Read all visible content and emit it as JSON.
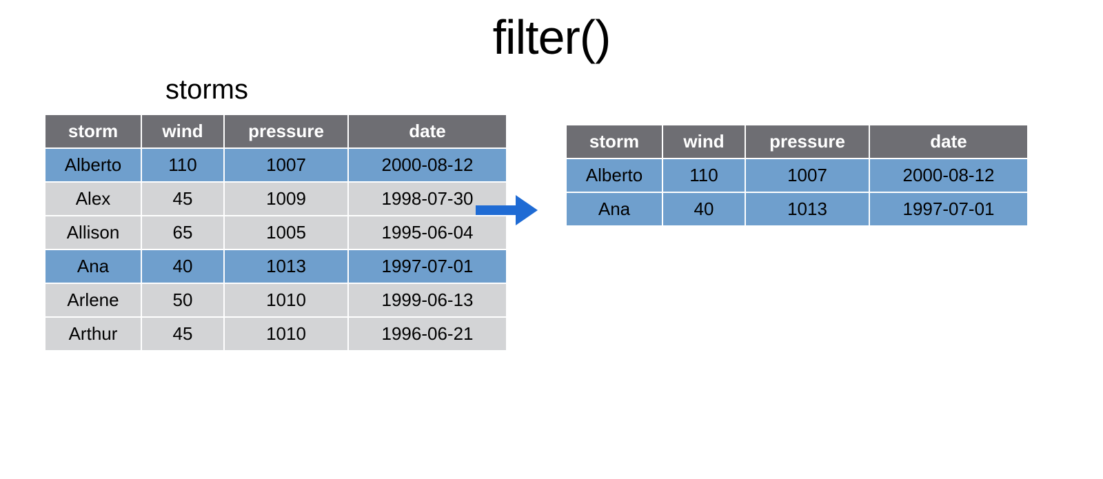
{
  "title": "filter()",
  "left_label": "storms",
  "columns": [
    "storm",
    "wind",
    "pressure",
    "date"
  ],
  "left_rows": [
    {
      "hl": true,
      "cells": [
        "Alberto",
        "110",
        "1007",
        "2000-08-12"
      ]
    },
    {
      "hl": false,
      "cells": [
        "Alex",
        "45",
        "1009",
        "1998-07-30"
      ]
    },
    {
      "hl": false,
      "cells": [
        "Allison",
        "65",
        "1005",
        "1995-06-04"
      ]
    },
    {
      "hl": true,
      "cells": [
        "Ana",
        "40",
        "1013",
        "1997-07-01"
      ]
    },
    {
      "hl": false,
      "cells": [
        "Arlene",
        "50",
        "1010",
        "1999-06-13"
      ]
    },
    {
      "hl": false,
      "cells": [
        "Arthur",
        "45",
        "1010",
        "1996-06-21"
      ]
    }
  ],
  "right_rows": [
    {
      "hl": true,
      "cells": [
        "Alberto",
        "110",
        "1007",
        "2000-08-12"
      ]
    },
    {
      "hl": true,
      "cells": [
        "Ana",
        "40",
        "1013",
        "1997-07-01"
      ]
    }
  ],
  "colors": {
    "header_bg": "#6e6e73",
    "row_plain": "#d3d4d6",
    "row_highlight": "#6f9fcd",
    "arrow": "#1f6bd4"
  },
  "chart_data": {
    "type": "table",
    "operation": "filter",
    "input_name": "storms",
    "columns": [
      "storm",
      "wind",
      "pressure",
      "date"
    ],
    "input": [
      {
        "storm": "Alberto",
        "wind": 110,
        "pressure": 1007,
        "date": "2000-08-12"
      },
      {
        "storm": "Alex",
        "wind": 45,
        "pressure": 1009,
        "date": "1998-07-30"
      },
      {
        "storm": "Allison",
        "wind": 65,
        "pressure": 1005,
        "date": "1995-06-04"
      },
      {
        "storm": "Ana",
        "wind": 40,
        "pressure": 1013,
        "date": "1997-07-01"
      },
      {
        "storm": "Arlene",
        "wind": 50,
        "pressure": 1010,
        "date": "1999-06-13"
      },
      {
        "storm": "Arthur",
        "wind": 45,
        "pressure": 1010,
        "date": "1996-06-21"
      }
    ],
    "output": [
      {
        "storm": "Alberto",
        "wind": 110,
        "pressure": 1007,
        "date": "2000-08-12"
      },
      {
        "storm": "Ana",
        "wind": 40,
        "pressure": 1013,
        "date": "1997-07-01"
      }
    ],
    "highlighted_input_indices": [
      0,
      3
    ]
  }
}
